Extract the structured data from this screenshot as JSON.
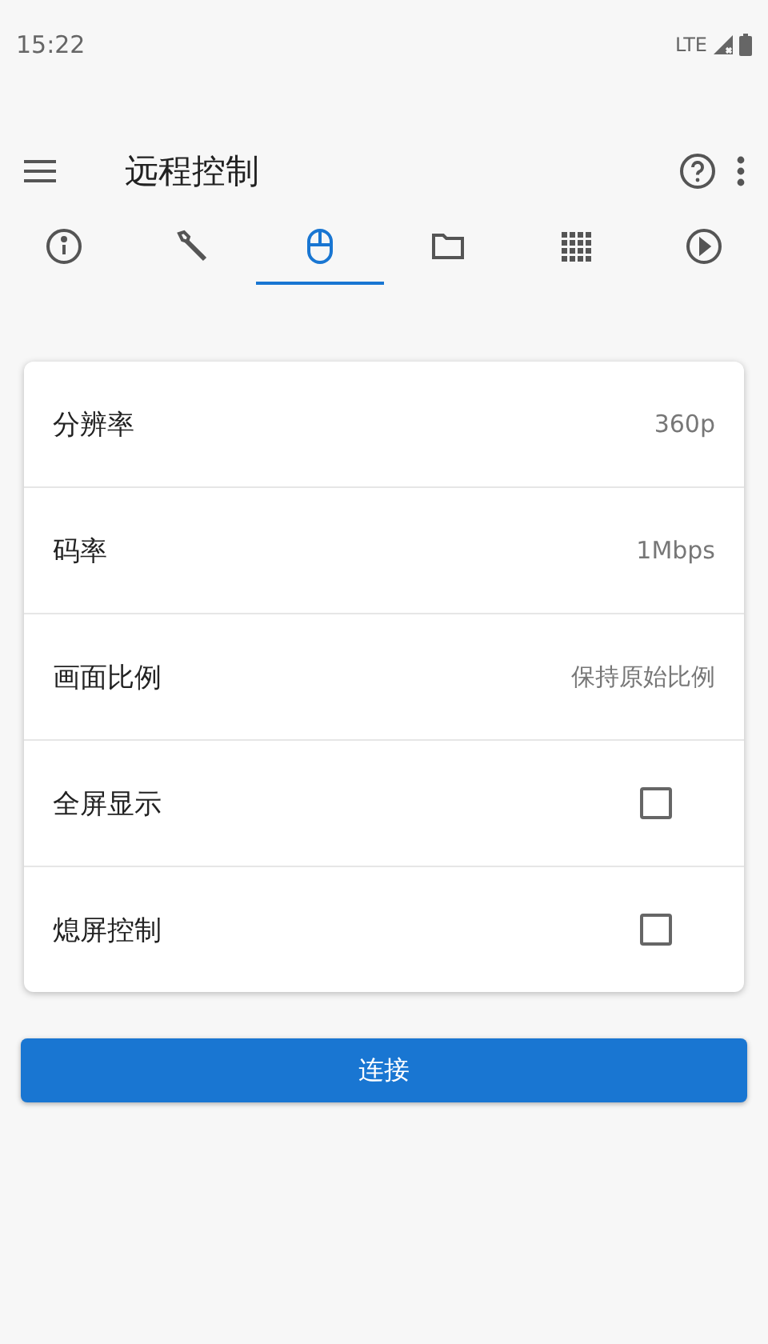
{
  "status_bar": {
    "time": "15:22",
    "network": "LTE"
  },
  "app_bar": {
    "title": "远程控制"
  },
  "tabs": [
    {
      "kind": "info",
      "selected": false
    },
    {
      "kind": "wrench",
      "selected": false
    },
    {
      "kind": "mouse",
      "selected": true
    },
    {
      "kind": "folder",
      "selected": false
    },
    {
      "kind": "grid",
      "selected": false
    },
    {
      "kind": "play",
      "selected": false
    }
  ],
  "settings": [
    {
      "kind": "value",
      "label": "分辨率",
      "value": "360p"
    },
    {
      "kind": "value",
      "label": "码率",
      "value": "1Mbps"
    },
    {
      "kind": "value",
      "label": "画面比例",
      "value": "保持原始比例"
    },
    {
      "kind": "checkbox",
      "label": "全屏显示",
      "checked": false
    },
    {
      "kind": "checkbox",
      "label": "熄屏控制",
      "checked": false
    }
  ],
  "connect_button": "连接"
}
